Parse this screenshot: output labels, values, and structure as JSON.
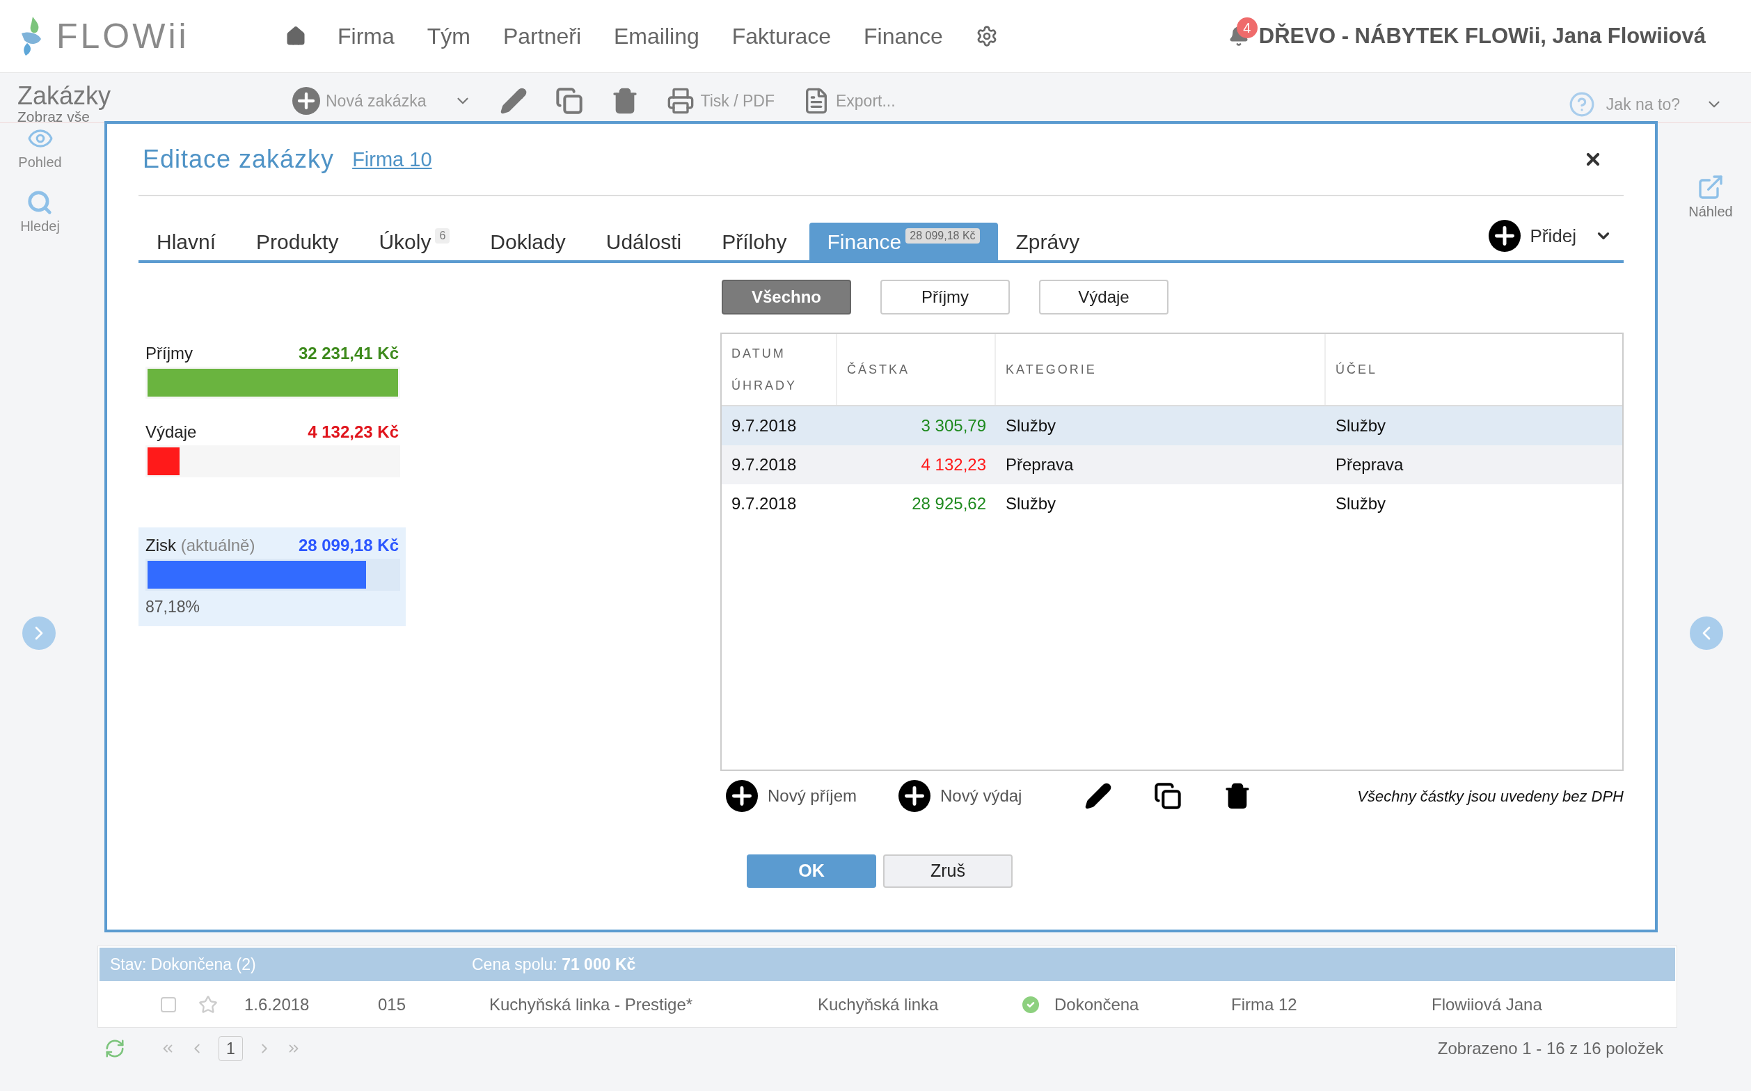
{
  "app": {
    "logo": "FLOWii"
  },
  "nav": {
    "items": [
      "Firma",
      "Tým",
      "Partneři",
      "Emailing",
      "Fakturace",
      "Finance"
    ],
    "notifications": "4",
    "account": "DŘEVO - NÁBYTEK FLOWii, Jana Flowiiová"
  },
  "page": {
    "title": "Zakázky",
    "subtitle": "Zobraz vše"
  },
  "toolbar": [
    {
      "kind": "add",
      "label": "Nová zakázka"
    },
    {
      "kind": "caret"
    },
    {
      "kind": "edit"
    },
    {
      "kind": "copy"
    },
    {
      "kind": "delete"
    },
    {
      "kind": "print",
      "label": "Tisk / PDF"
    },
    {
      "kind": "export",
      "label": "Export..."
    }
  ],
  "help": "Jak na to?",
  "sidebar": [
    {
      "kind": "view",
      "label": "Pohled"
    },
    {
      "kind": "search",
      "label": "Hledej"
    }
  ],
  "preview": "Náhled",
  "dialog": {
    "title": "Editace zakázky",
    "link": "Firma 10",
    "tabs": [
      {
        "label": "Hlavní",
        "selected": false
      },
      {
        "label": "Produkty",
        "selected": false
      },
      {
        "label": "Úkoly",
        "badge": "6",
        "selected": false
      },
      {
        "label": "Doklady",
        "selected": false
      },
      {
        "label": "Události",
        "selected": false
      },
      {
        "label": "Přílohy",
        "selected": false
      },
      {
        "label": "Finance",
        "badge": "28 099,18 Kč",
        "selected": true
      },
      {
        "label": "Zprávy",
        "selected": false
      }
    ],
    "add_button": "Přidej",
    "summary": [
      {
        "kind": "income",
        "label": "Příjmy",
        "amount": "32 231,41 Kč",
        "level": 1
      },
      {
        "kind": "expense",
        "label": "Výdaje",
        "amount": "4 132,23 Kč",
        "level": 0.128
      },
      {
        "kind": "profit",
        "label": "Zisk",
        "note": "(aktuálně)",
        "amount": "28 099,18 Kč",
        "level": 0.872,
        "percent": "87,18%"
      }
    ],
    "filters": [
      {
        "label": "Všechno",
        "selected": true
      },
      {
        "label": "Příjmy",
        "selected": false
      },
      {
        "label": "Výdaje",
        "selected": false
      }
    ],
    "table": {
      "columns": [
        "DATUM ÚHRADY",
        "ČÁSTKA",
        "KATEGORIE",
        "ÚČEL"
      ],
      "rows": [
        {
          "date": "9.7.2018",
          "amount": "3 305,79",
          "kind": "income",
          "category": "Služby",
          "purpose": "Služby",
          "selected": true
        },
        {
          "date": "9.7.2018",
          "amount": "4 132,23",
          "kind": "expense",
          "category": "Přeprava",
          "purpose": "Přeprava",
          "selected": false
        },
        {
          "date": "9.7.2018",
          "amount": "28 925,62",
          "kind": "income",
          "category": "Služby",
          "purpose": "Služby",
          "selected": false
        }
      ]
    },
    "actions": [
      {
        "kind": "add",
        "label": "Nový příjem"
      },
      {
        "kind": "add",
        "label": "Nový výdaj"
      },
      {
        "kind": "edit"
      },
      {
        "kind": "copy"
      },
      {
        "kind": "delete"
      }
    ],
    "note": "Všechny částky jsou uvedeny bez DPH",
    "ok": "OK",
    "cancel": "Zruš"
  },
  "grid": {
    "group": {
      "label": "Stav: Dokončena (2)",
      "total": "Cena spolu: **71 000 Kč**"
    },
    "rows": [
      {
        "checked": false,
        "starred": false,
        "date": "1.6.2018",
        "number": "015",
        "name": "Kuchyňská linka - Prestige*",
        "type": "Kuchyňská linka",
        "status": "Dokončena",
        "done": true,
        "company": "Firma 12",
        "owner": "Flowiiová Jana"
      }
    ]
  },
  "pager": {
    "page": "1",
    "info": "Zobrazeno 1 - 16 z 16 položek"
  }
}
